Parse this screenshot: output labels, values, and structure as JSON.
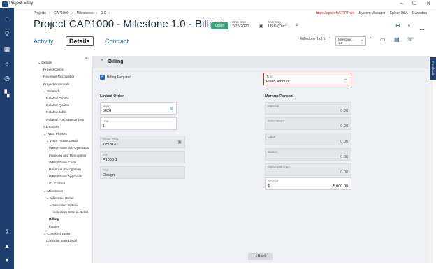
{
  "window": {
    "title": "Project Entry",
    "minimize": "–",
    "maximize": "☐",
    "close": "✕"
  },
  "rail": {
    "icons": [
      "home-icon",
      "search-icon",
      "grid-icon",
      "star-icon",
      "history-icon",
      "dashboard-icon",
      "help-icon",
      "bell-icon",
      "user-icon"
    ]
  },
  "breadcrumb": [
    "Projects",
    "CAP1000",
    "Milestones",
    "1.0"
  ],
  "topright": {
    "url": "https://epicorfc/ERPTrain",
    "role": "System Manager",
    "company": "Epicor USA",
    "site": "Evanston"
  },
  "page_title": "Project CAP1000 - Milestone 1.0 - Billing",
  "status_badge": "Open",
  "start_date": {
    "label": "Start Date",
    "value": "7/25/2020"
  },
  "currency": {
    "label": "Currency",
    "value": "USD (Dec)"
  },
  "tabs": [
    {
      "label": "Activity",
      "active": false
    },
    {
      "label": "Details",
      "active": true
    },
    {
      "label": "Contract",
      "active": false
    }
  ],
  "milestone_nav": {
    "counter": "Milestone 1 of 5",
    "select_label": "Milestone...",
    "select_value": "1.0"
  },
  "tree": [
    {
      "label": "⌄ Details",
      "indent": 0,
      "bold": false
    },
    {
      "label": "Project Costs",
      "indent": 1,
      "bold": false
    },
    {
      "label": "Revenue Recognition",
      "indent": 1,
      "bold": false
    },
    {
      "label": "Project Approvals",
      "indent": 1,
      "bold": false
    },
    {
      "label": "⌄ Related",
      "indent": 1,
      "bold": false
    },
    {
      "label": "Related Orders",
      "indent": 2,
      "bold": false
    },
    {
      "label": "Related Quotes",
      "indent": 2,
      "bold": false
    },
    {
      "label": "Related Jobs",
      "indent": 2,
      "bold": false
    },
    {
      "label": "Related Purchase Orders",
      "indent": 2,
      "bold": false
    },
    {
      "label": "GL Control",
      "indent": 1,
      "bold": false
    },
    {
      "label": "⌄ WBS Phases",
      "indent": 1,
      "bold": false
    },
    {
      "label": "⌄ WBS Phase Detail",
      "indent": 2,
      "bold": false
    },
    {
      "label": "WBS Phase Job Operation",
      "indent": 3,
      "bold": false
    },
    {
      "label": "Invoicing and Recognition",
      "indent": 3,
      "bold": false
    },
    {
      "label": "WBS Phase Costs",
      "indent": 3,
      "bold": false
    },
    {
      "label": "Revenue Recognition",
      "indent": 3,
      "bold": false
    },
    {
      "label": "WBS Phase Approvals",
      "indent": 3,
      "bold": false
    },
    {
      "label": "GL Control",
      "indent": 3,
      "bold": false
    },
    {
      "label": "⌄ Milestones",
      "indent": 1,
      "bold": false
    },
    {
      "label": "⌄ Milestone Detail",
      "indent": 2,
      "bold": false
    },
    {
      "label": "⌄ Selection Criteria",
      "indent": 3,
      "bold": false
    },
    {
      "label": "Selection Criteria Detail",
      "indent": 4,
      "bold": false
    },
    {
      "label": "Billing",
      "indent": 3,
      "bold": true
    },
    {
      "label": "Invoice",
      "indent": 3,
      "bold": false
    },
    {
      "label": "⌄ Checklist Tasks",
      "indent": 1,
      "bold": false
    },
    {
      "label": "Checklist Task Detail",
      "indent": 2,
      "bold": false
    }
  ],
  "section": {
    "title": "Billing"
  },
  "billing_required": {
    "label": "Billing Required",
    "checked": true
  },
  "type_field": {
    "label": "Type",
    "value": "Fixed Amount"
  },
  "linked_order": {
    "title": "Linked Order",
    "order": {
      "label": "Order",
      "value": "5020"
    },
    "line": {
      "label": "Line",
      "value": "1"
    },
    "order_date": {
      "label": "Order Date",
      "value": "7/5/2020"
    },
    "po": {
      "label": "PO",
      "value": "P1000-1"
    },
    "part": {
      "label": "Part",
      "value": "Design"
    }
  },
  "markup": {
    "title": "Markup Percent",
    "material": {
      "label": "Material",
      "value": "0.00"
    },
    "subcontract": {
      "label": "Subcontract",
      "value": "0.00"
    },
    "labor": {
      "label": "Labor",
      "value": "0.00"
    },
    "burden": {
      "label": "Burden",
      "value": "0.00"
    },
    "material_burden": {
      "label": "Material Burden",
      "value": "0.00"
    },
    "amount": {
      "label": "Amount",
      "currency": "$",
      "value": "5,000.00"
    }
  },
  "back_button": "Back",
  "feedback": "Feedback",
  "colors": {
    "rail": "#1f3f6f",
    "accent": "#2a6ebb",
    "open_badge": "#3aa57a",
    "url": "#c0302a"
  }
}
